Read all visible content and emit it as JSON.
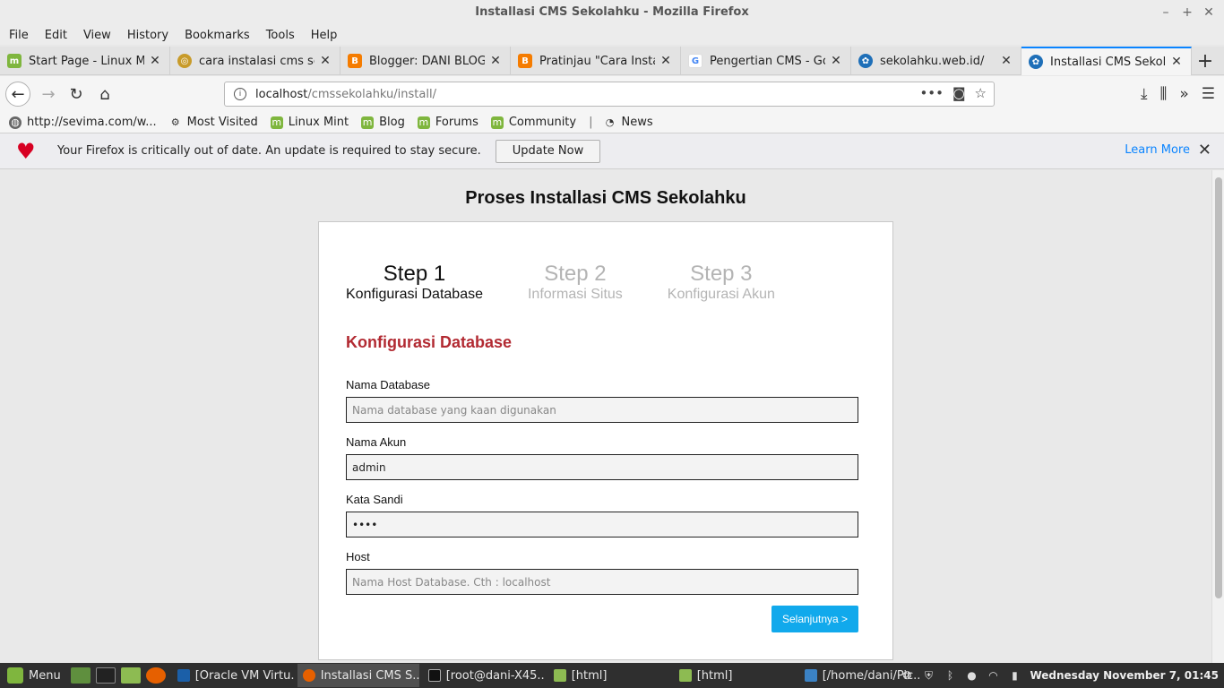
{
  "window": {
    "title": "Installasi CMS Sekolahku - Mozilla Firefox"
  },
  "menu": [
    "File",
    "Edit",
    "View",
    "History",
    "Bookmarks",
    "Tools",
    "Help"
  ],
  "tabs": [
    {
      "title": "Start Page - Linux Mint",
      "icon": "linux-mint-icon",
      "color": "#7fb63e"
    },
    {
      "title": "cara instalasi cms seko",
      "icon": "site-icon",
      "color": "#c89b2a"
    },
    {
      "title": "Blogger: DANI BLOG - C",
      "icon": "blogger-icon",
      "color": "#f57c00"
    },
    {
      "title": "Pratinjau \"Cara Installa",
      "icon": "blogger-icon",
      "color": "#f57c00"
    },
    {
      "title": "Pengertian CMS - Goog",
      "icon": "google-icon",
      "color": "#4285f4"
    },
    {
      "title": "sekolahku.web.id/",
      "icon": "sekolahku-icon",
      "color": "#1e6fb8"
    },
    {
      "title": "Installasi CMS Sekolahk",
      "icon": "sekolahku-icon",
      "color": "#1e6fb8"
    }
  ],
  "url": {
    "host": "localhost",
    "path": "/cmssekolahku/install/"
  },
  "bookmarks": [
    {
      "label": "http://sevima.com/w...",
      "icon": "globe-icon"
    },
    {
      "label": "Most Visited",
      "icon": "gear-icon"
    },
    {
      "label": "Linux Mint",
      "icon": "linux-mint-icon"
    },
    {
      "label": "Blog",
      "icon": "linux-mint-icon"
    },
    {
      "label": "Forums",
      "icon": "linux-mint-icon"
    },
    {
      "label": "Community",
      "icon": "linux-mint-icon"
    },
    {
      "label": "News",
      "icon": "rss-icon"
    }
  ],
  "notification": {
    "message": "Your Firefox is critically out of date. An update is required to stay secure.",
    "button": "Update Now",
    "link": "Learn More"
  },
  "page": {
    "title": "Proses Installasi CMS Sekolahku",
    "steps": [
      {
        "num": "Step 1",
        "label": "Konfigurasi Database",
        "active": true
      },
      {
        "num": "Step 2",
        "label": "Informasi Situs",
        "active": false
      },
      {
        "num": "Step 3",
        "label": "Konfigurasi Akun",
        "active": false
      }
    ],
    "section_title": "Konfigurasi Database",
    "fields": {
      "db_name": {
        "label": "Nama Database",
        "value": "",
        "placeholder": "Nama database yang kaan digunakan"
      },
      "db_user": {
        "label": "Nama Akun",
        "value": "admin",
        "placeholder": ""
      },
      "db_pass": {
        "label": "Kata Sandi",
        "value": "1234",
        "placeholder": ""
      },
      "db_host": {
        "label": "Host",
        "value": "",
        "placeholder": "Nama Host Database. Cth : localhost"
      }
    },
    "next_button": "Selanjutnya >"
  },
  "taskbar": {
    "menu_label": "Menu",
    "windows": [
      {
        "title": "[Oracle VM Virtu...",
        "active": false
      },
      {
        "title": "Installasi CMS S...",
        "active": true
      },
      {
        "title": "[root@dani-X45...",
        "active": false
      },
      {
        "title": "[html]",
        "active": false
      },
      {
        "title": "[html]",
        "active": false
      },
      {
        "title": "[/home/dani/Pic...",
        "active": false
      }
    ],
    "clock": "Wednesday November  7, 01:45"
  }
}
